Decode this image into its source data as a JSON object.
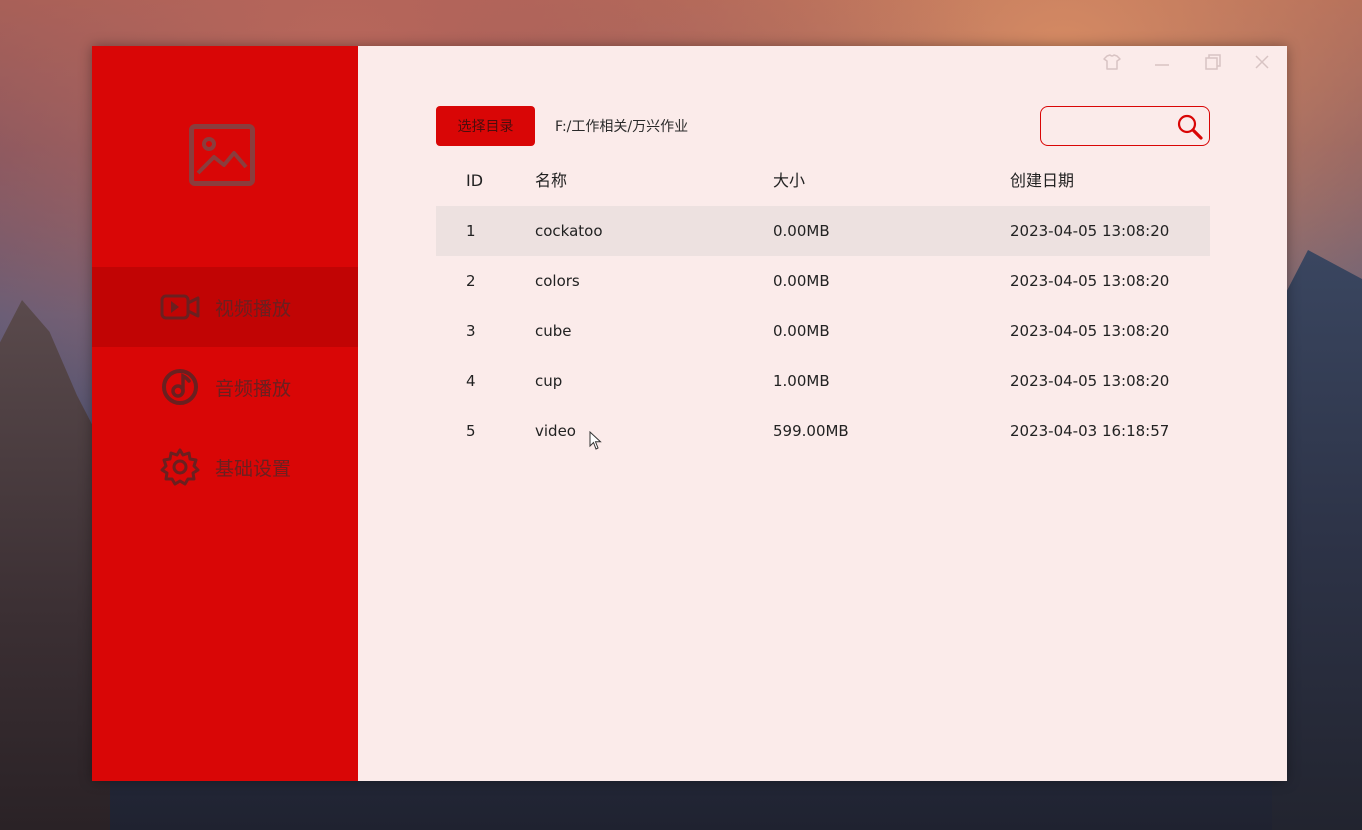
{
  "sidebar": {
    "items": [
      {
        "label": "视频播放",
        "icon": "video-camera-icon",
        "active": true
      },
      {
        "label": "音频播放",
        "icon": "music-note-icon",
        "active": false
      },
      {
        "label": "基础设置",
        "icon": "gear-icon",
        "active": false
      }
    ]
  },
  "toolbar": {
    "select_dir_label": "选择目录",
    "path": "F:/工作相关/万兴作业",
    "search_placeholder": ""
  },
  "table": {
    "columns": [
      "ID",
      "名称",
      "大小",
      "创建日期"
    ],
    "rows": [
      {
        "id": "1",
        "name": "cockatoo",
        "size": "0.00MB",
        "date": "2023-04-05 13:08:20"
      },
      {
        "id": "2",
        "name": "colors",
        "size": "0.00MB",
        "date": "2023-04-05 13:08:20"
      },
      {
        "id": "3",
        "name": "cube",
        "size": "0.00MB",
        "date": "2023-04-05 13:08:20"
      },
      {
        "id": "4",
        "name": "cup",
        "size": "1.00MB",
        "date": "2023-04-05 13:08:20"
      },
      {
        "id": "5",
        "name": "video",
        "size": "599.00MB",
        "date": "2023-04-03 16:18:57"
      }
    ]
  },
  "colors": {
    "sidebar_bg": "#d90606",
    "sidebar_active": "#c10404",
    "content_bg": "#fbebea",
    "row_selected": "#ede1e0",
    "icon_dark": "#8a3d3d"
  }
}
